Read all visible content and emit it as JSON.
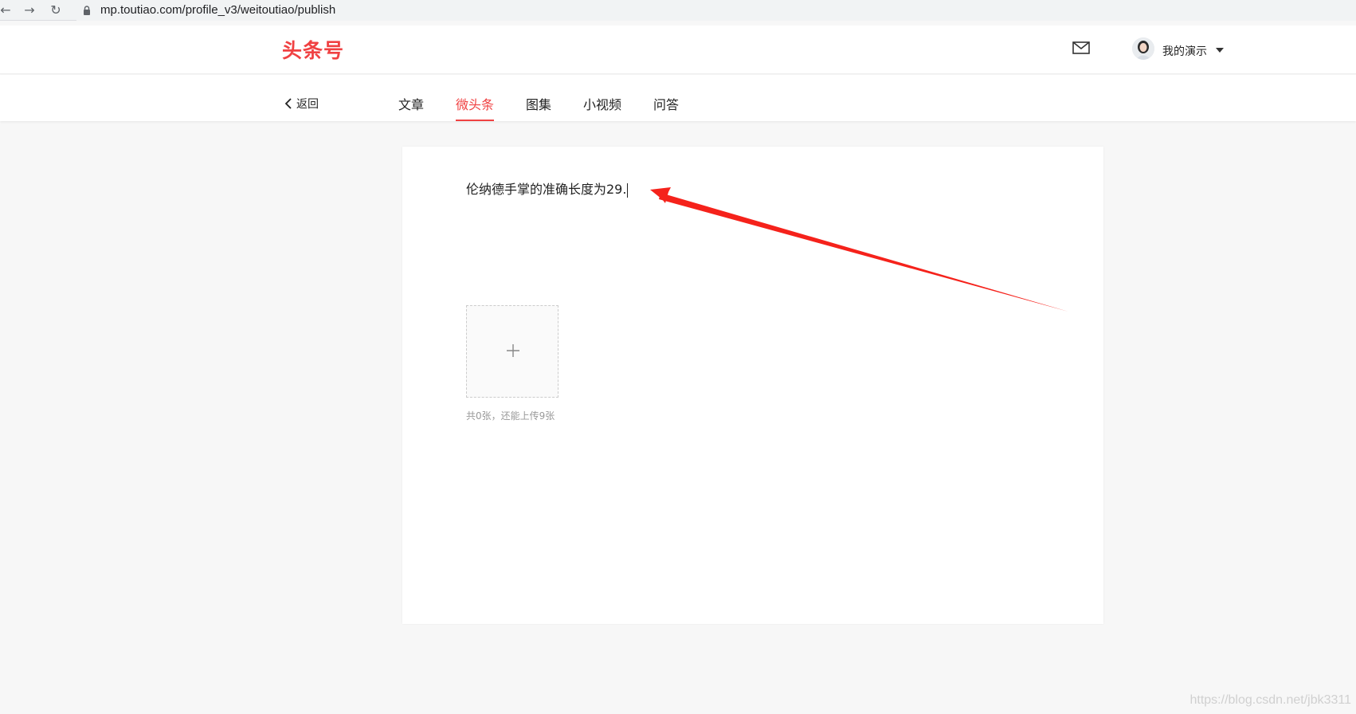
{
  "browser": {
    "url": "mp.toutiao.com/profile_v3/weitoutiao/publish",
    "back_icon": "back-arrow-icon",
    "forward_icon": "forward-arrow-icon",
    "reload_icon": "reload-icon"
  },
  "header": {
    "logo": "头条号",
    "user_name": "我的演示",
    "brand_color": "#f04142"
  },
  "tabs_bar": {
    "back_label": "返回",
    "tabs": [
      {
        "label": "文章",
        "active": false
      },
      {
        "label": "微头条",
        "active": true
      },
      {
        "label": "图集",
        "active": false
      },
      {
        "label": "小视频",
        "active": false
      },
      {
        "label": "问答",
        "active": false
      }
    ]
  },
  "editor": {
    "content": "伦纳德手掌的准确长度为29."
  },
  "upload": {
    "hint": "共0张，还能上传9张"
  },
  "annotation": {
    "arrow_color": "#f5221b"
  },
  "watermark": "https://blog.csdn.net/jbk3311"
}
